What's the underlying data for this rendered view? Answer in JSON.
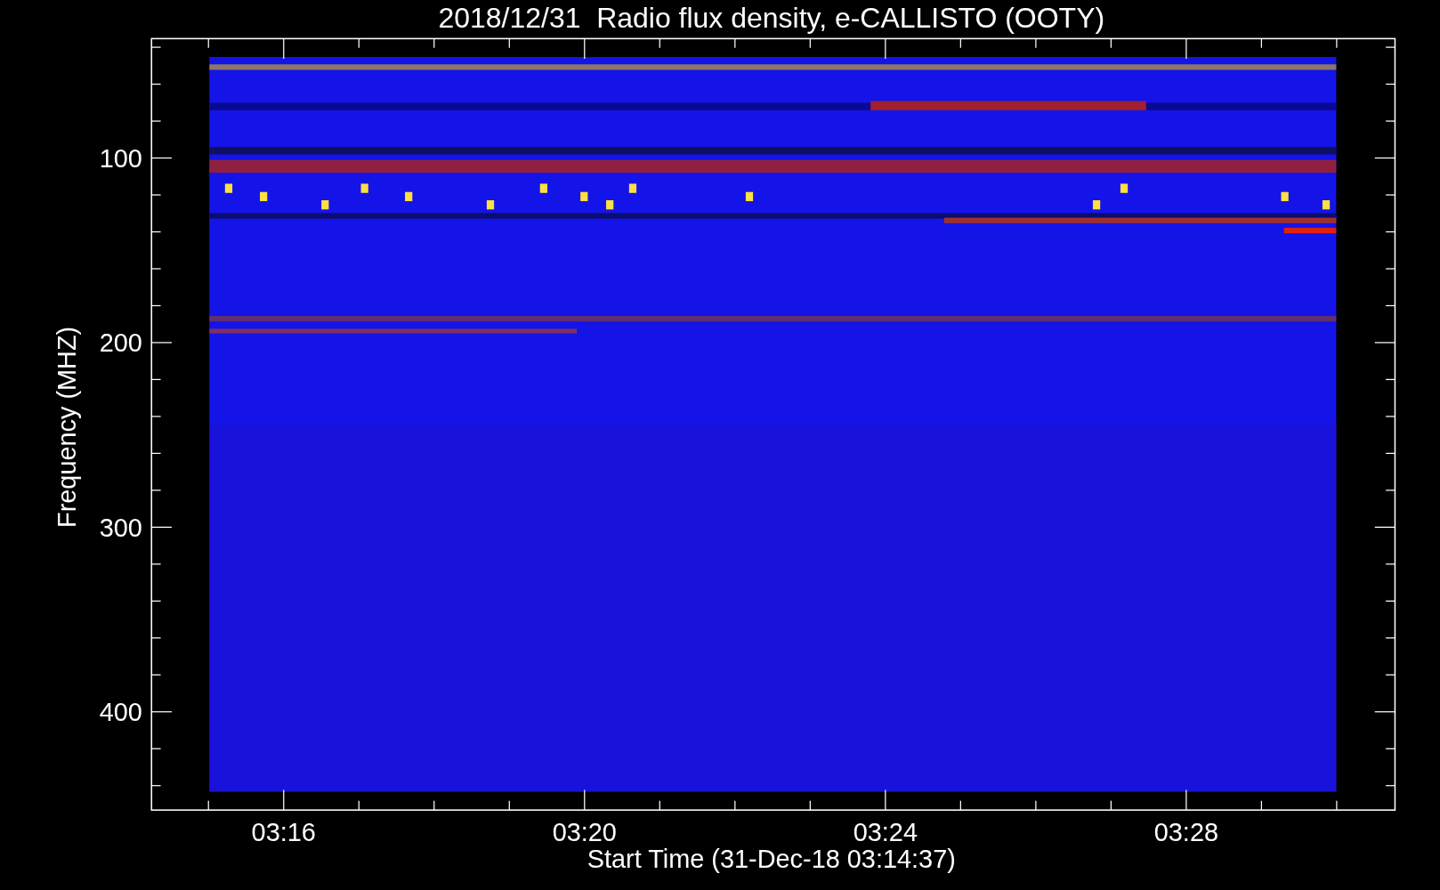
{
  "title": "2018/12/31  Radio flux density, e-CALLISTO (OOTY)",
  "y_axis": {
    "label": "Frequency (MHZ)",
    "ticks": [
      "100",
      "200",
      "300",
      "400"
    ]
  },
  "x_axis": {
    "label": "Start Time (31-Dec-18 03:14:37)",
    "ticks": [
      "03:16",
      "03:20",
      "03:24",
      "03:28"
    ]
  }
}
